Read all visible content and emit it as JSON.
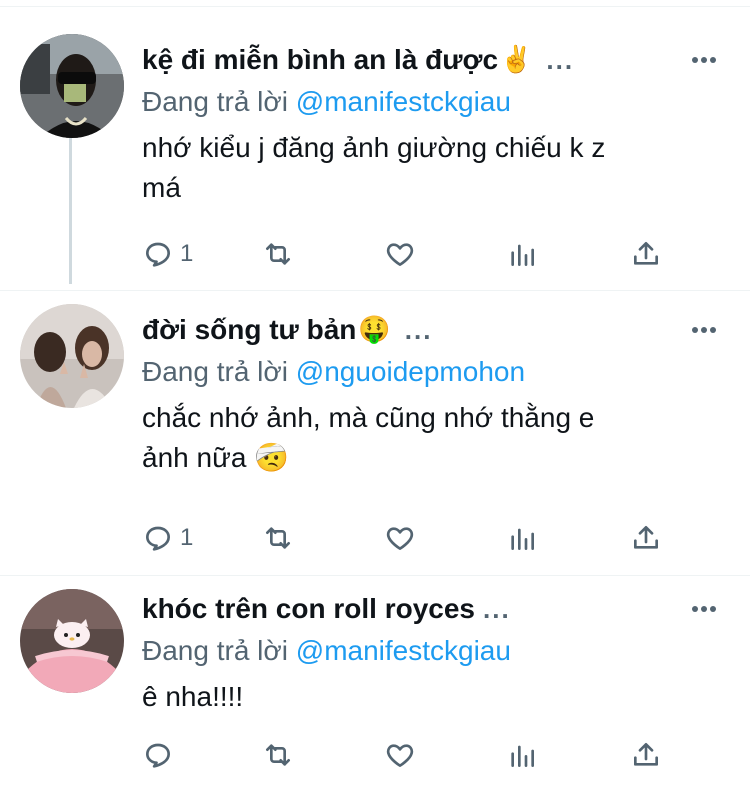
{
  "tweets": [
    {
      "username": "kệ đi miễn bình an là được",
      "emoji": "✌️",
      "dots": "...",
      "reply_prefix": "Đang trả lời",
      "reply_handle": "@manifestckgiau",
      "text_line1": "nhớ kiểu j đăng ảnh giường chiếu k z",
      "text_line2": "má",
      "reply_count": "1",
      "avatar_icon": "avatar-person-sunglasses"
    },
    {
      "username": "đời sống tư bản",
      "emoji": "🤑",
      "dots": "...",
      "reply_prefix": "Đang trả lời",
      "reply_handle": "@nguoidepmohon",
      "text_line1": "chắc nhớ ảnh, mà cũng nhớ thằng e",
      "text_line2": "ảnh nữa 🤕",
      "reply_count": "1",
      "avatar_icon": "avatar-praying-women"
    },
    {
      "username": "khóc trên con roll royces",
      "emoji": "",
      "dots": "...",
      "reply_prefix": "Đang trả lời",
      "reply_handle": "@manifestckgiau",
      "text_line1": "ê nha!!!!",
      "text_line2": "",
      "reply_count": "",
      "avatar_icon": "avatar-hello-kitty-bed"
    }
  ],
  "icons": [
    "reply-icon",
    "retweet-icon",
    "like-icon",
    "analytics-icon",
    "share-icon",
    "more-icon"
  ],
  "colors": {
    "accent": "#1d9bf0",
    "muted": "#536471",
    "text": "#0f1419",
    "thread_line": "#cfd9de"
  }
}
